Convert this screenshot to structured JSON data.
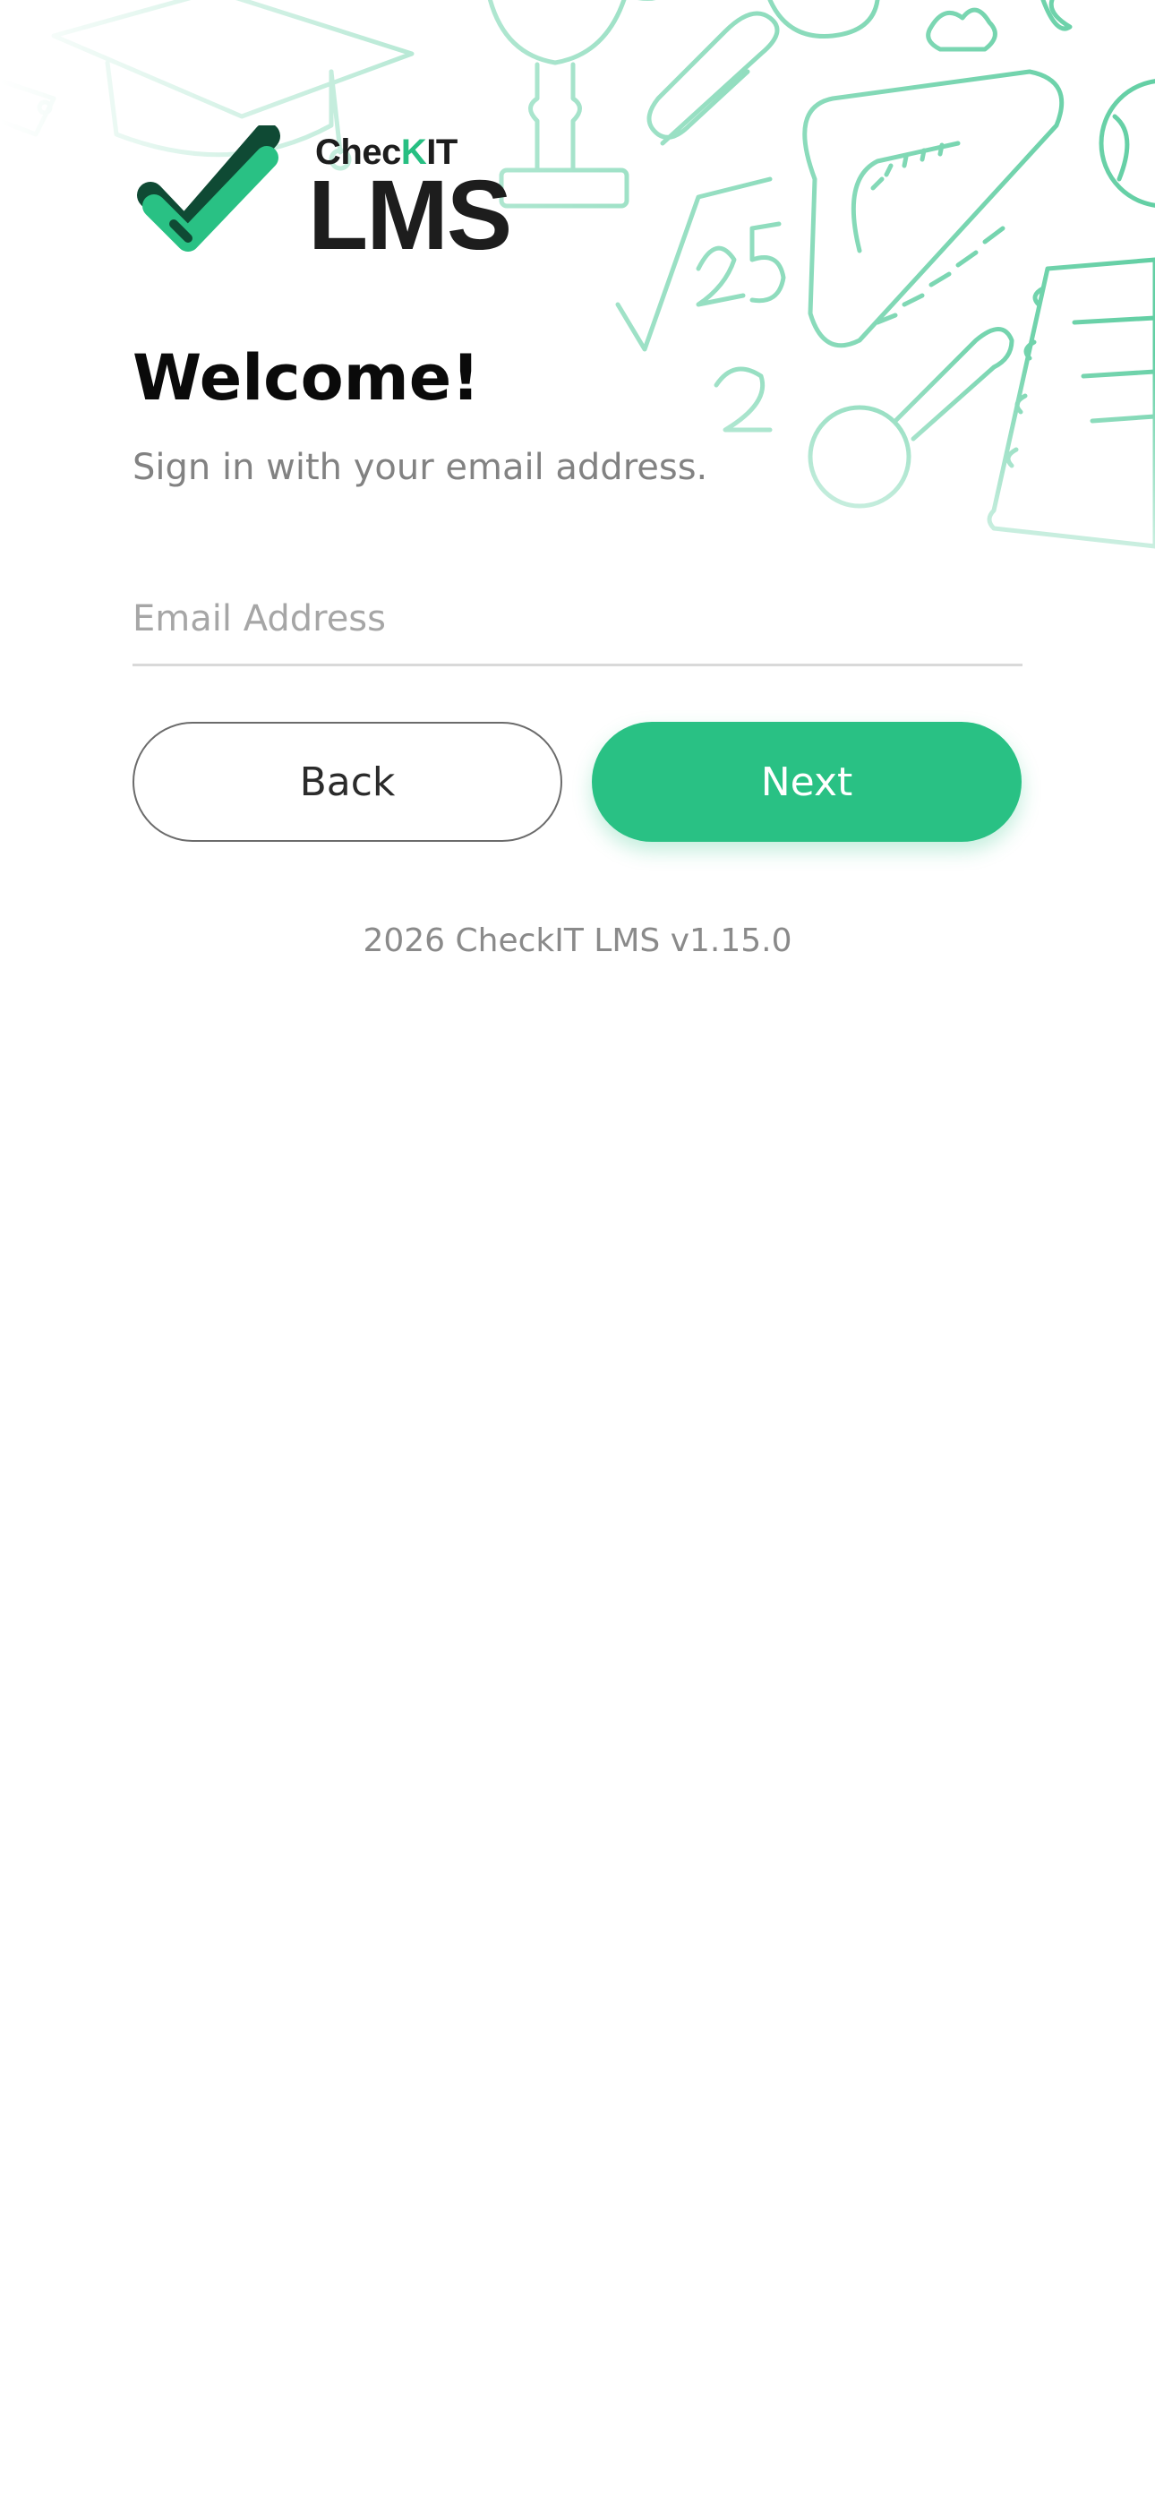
{
  "logo": {
    "small_prefix": "Chec",
    "small_accent": "K",
    "small_suffix": "IT",
    "big": "LMS"
  },
  "welcome": {
    "title": "Welcome!",
    "subtitle": "Sign in with your email address."
  },
  "email": {
    "placeholder": "Email Address",
    "value": ""
  },
  "buttons": {
    "back_label": "Back",
    "next_label": "Next"
  },
  "footer": {
    "text": "2026 CheckIT LMS v1.15.0"
  },
  "colors": {
    "accent": "#29c184",
    "accent_dark": "#0f4a34",
    "doodle": "#8fdcbd"
  },
  "icons": {
    "logo_mark": "checkmark-logo-icon"
  }
}
